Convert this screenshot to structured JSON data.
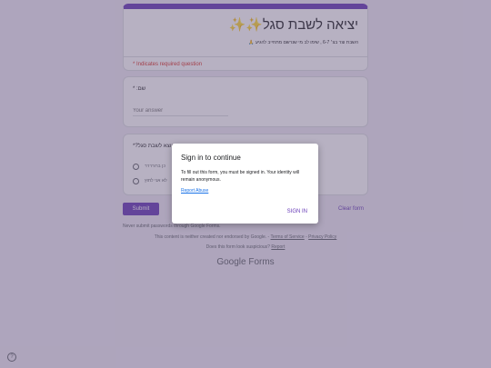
{
  "form": {
    "title": "יציאה לשבת סגל✨✨",
    "description": "השבת וצר בצ׳ 6-7 , שימו לב מי שנרשם מתחייב להגיע 🙏",
    "required_note": "* Indicates required question",
    "accent_color": "#673ab7"
  },
  "questions": {
    "name_label": "שם: *",
    "name_placeholder": "Your answer",
    "attend_label": "יוצא לשבת סגל?*",
    "options": [
      "כן ברורררר",
      "לא אני לחוץ"
    ]
  },
  "actions": {
    "submit": "Submit",
    "clear": "Clear form"
  },
  "footer": {
    "never_submit": "Never submit passwords through Google Forms.",
    "disclaimer": "This content is neither created nor endorsed by Google. -",
    "terms": "Terms of Service",
    "privacy": "Privacy Policy",
    "suspicious": "Does this form look suspicious?",
    "report": "Report",
    "logo_google": "Google",
    "logo_forms": "Forms"
  },
  "dialog": {
    "title": "Sign in to continue",
    "body": "To fill out this form, you must be signed in. Your identity will remain anonymous.",
    "report_link": "Report Abuse",
    "sign_in": "SIGN IN"
  },
  "icons": {
    "help": "help-icon"
  }
}
